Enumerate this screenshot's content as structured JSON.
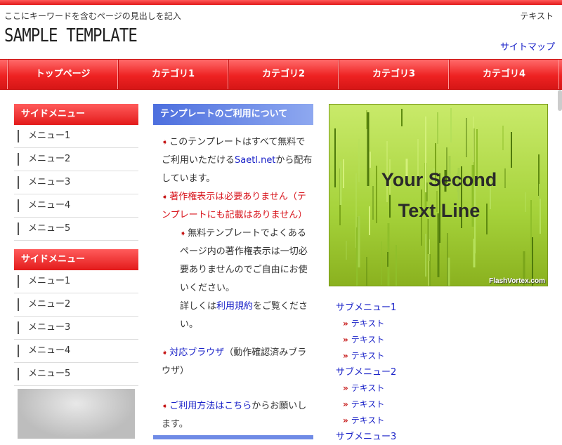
{
  "header": {
    "tagline": "ここにキーワードを含むページの見出しを記入",
    "top_link": "テキスト",
    "logo": "SAMPLE TEMPLATE",
    "sitemap": "サイトマップ"
  },
  "nav": [
    "トップページ",
    "カテゴリ1",
    "カテゴリ2",
    "カテゴリ3",
    "カテゴリ4"
  ],
  "sidebar": [
    {
      "title": "サイドメニュー",
      "items": [
        "メニュー1",
        "メニュー2",
        "メニュー3",
        "メニュー4",
        "メニュー5"
      ]
    },
    {
      "title": "サイドメニュー",
      "items": [
        "メニュー1",
        "メニュー2",
        "メニュー3",
        "メニュー4",
        "メニュー5"
      ]
    }
  ],
  "main": {
    "title": "テンプレートのご利用について",
    "p1_a": "このテンプレートはすべて無料でご利用いただける",
    "p1_link": "Saetl.net",
    "p1_b": "から配布しています。",
    "p2": "著作権表示は必要ありません（テンプレートにも記載はありません）",
    "p3": "無料テンプレートでよくあるページ内の著作権表示は一切必要ありませんのでご自由にお使いください。",
    "p4_a": "詳しくは",
    "p4_link": "利用規約",
    "p4_b": "をご覧ください。",
    "p5_link": "対応ブラウザ",
    "p5_b": "（動作確認済みブラウザ）",
    "p6_link": "ご利用方法はこちら",
    "p6_b": "からお願いします。"
  },
  "flash": {
    "line1": "Your Second",
    "line2": "Text Line",
    "credit": "FlashVortex.com"
  },
  "submenus": [
    {
      "title": "サブメニュー1",
      "items": [
        "テキスト",
        "テキスト",
        "テキスト"
      ]
    },
    {
      "title": "サブメニュー2",
      "items": [
        "テキスト",
        "テキスト",
        "テキスト"
      ]
    },
    {
      "title": "サブメニュー3",
      "items": []
    }
  ],
  "colors": {
    "accent_red": "#e31b1b",
    "link_blue": "#1a22c8",
    "header_blue": "#4d6fde"
  }
}
